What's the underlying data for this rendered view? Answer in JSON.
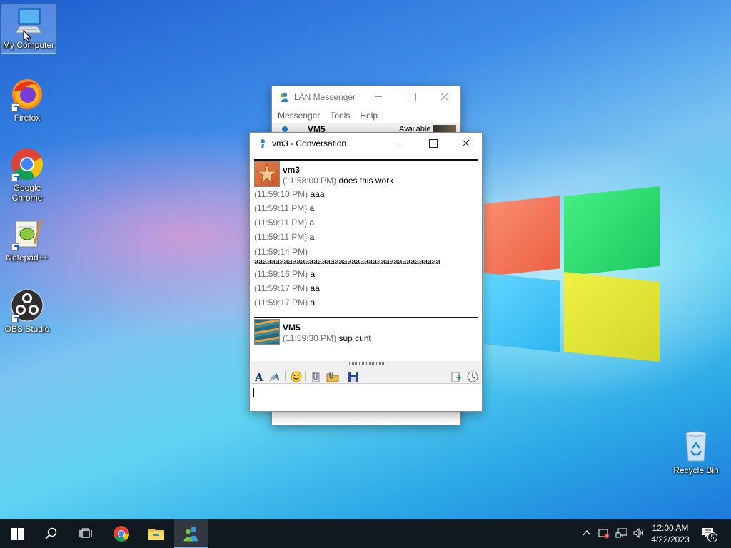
{
  "desktop": {
    "icons": [
      {
        "label": "My Computer"
      },
      {
        "label": "Firefox"
      },
      {
        "label": "Google Chrome"
      },
      {
        "label": "Notepad++"
      },
      {
        "label": "OBS Studio"
      },
      {
        "label": "Recycle Bin"
      }
    ]
  },
  "lan_window": {
    "title": "LAN Messenger",
    "menu": [
      "Messenger",
      "Tools",
      "Help"
    ],
    "contact": {
      "name": "VM5",
      "status": "Available"
    }
  },
  "conversation": {
    "title": "vm3 - Conversation",
    "blocks": [
      {
        "sender": "vm3",
        "messages": [
          {
            "time": "(11:58:00 PM)",
            "text": "does this work"
          },
          {
            "time": "(11:59:10 PM)",
            "text": "aaa"
          },
          {
            "time": "(11:59:11 PM)",
            "text": "a"
          },
          {
            "time": "(11:59:11 PM)",
            "text": "a"
          },
          {
            "time": "(11:59:11 PM)",
            "text": "a"
          },
          {
            "time": "(11:59:14 PM)",
            "text": "aaaaaaaaaaaaaaaaaaaaaaaaaaaaaaaaaaaaaaaaaaaa"
          },
          {
            "time": "(11:59:16 PM)",
            "text": "a"
          },
          {
            "time": "(11:59:17 PM)",
            "text": "aa"
          },
          {
            "time": "(11:59:17 PM)",
            "text": "a"
          }
        ]
      },
      {
        "sender": "VM5",
        "messages": [
          {
            "time": "(11:59:30 PM)",
            "text": "sup cunt"
          }
        ]
      }
    ],
    "input_value": ""
  },
  "taskbar": {
    "clock_time": "12:00 AM",
    "clock_date": "4/22/2023",
    "notification_count": "5"
  },
  "colors": {
    "taskbar_bg": "#101820",
    "accent": "#76b9ed",
    "timestamp": "#6e6e6e"
  }
}
